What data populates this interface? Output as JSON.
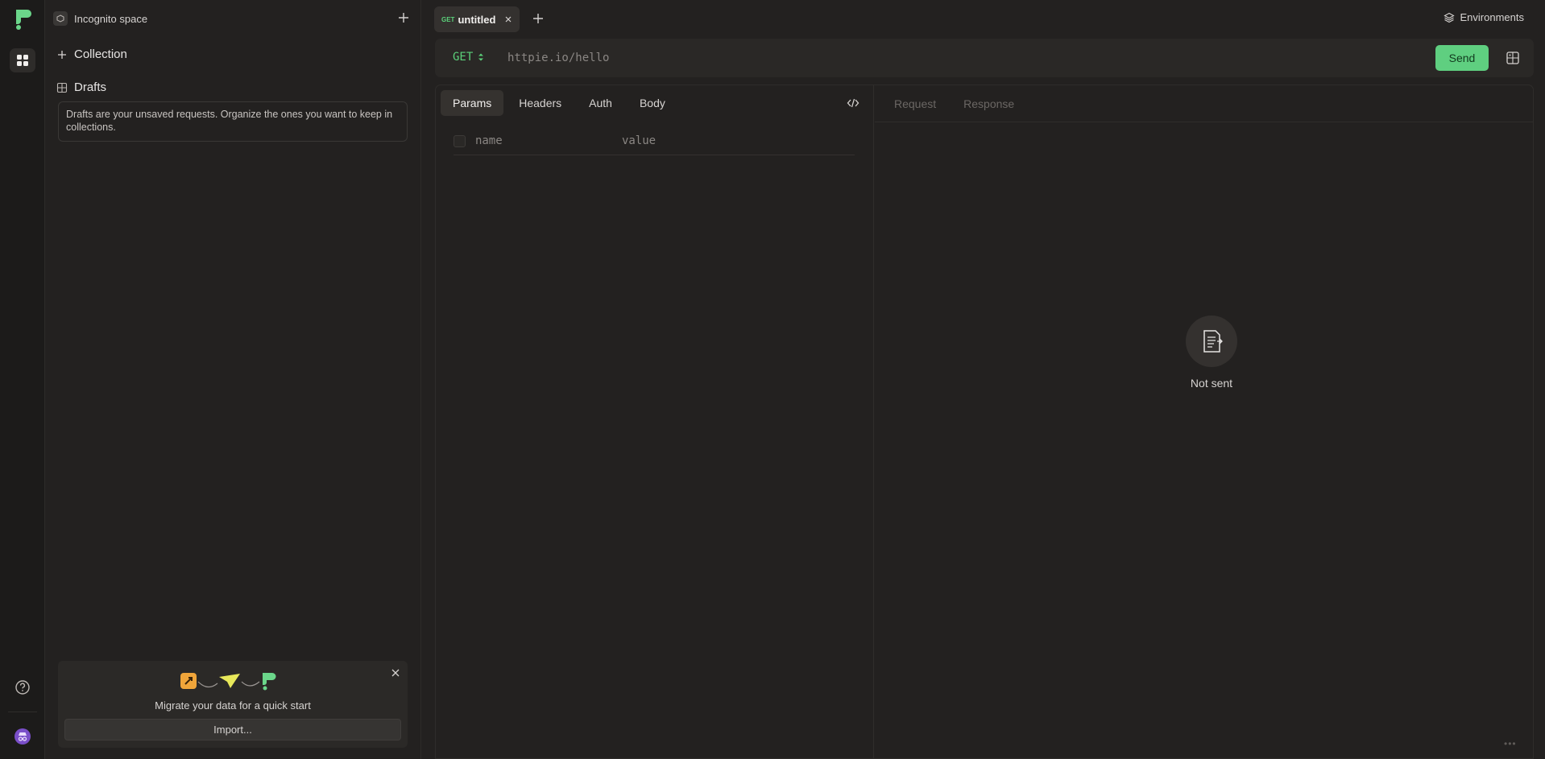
{
  "sidebar": {
    "space_name": "Incognito space",
    "collection_label": "Collection",
    "drafts_label": "Drafts",
    "drafts_note": "Drafts are your unsaved requests. Organize the ones you want to keep in collections."
  },
  "migrate": {
    "text": "Migrate your data for a quick start",
    "import_label": "Import..."
  },
  "tabs": [
    {
      "method": "GET",
      "title": "untitled"
    }
  ],
  "header": {
    "environments_label": "Environments"
  },
  "request": {
    "method": "GET",
    "url_placeholder": "httpie.io/hello",
    "send_label": "Send",
    "subtabs": [
      "Params",
      "Headers",
      "Auth",
      "Body"
    ],
    "params": {
      "name_placeholder": "name",
      "value_placeholder": "value"
    }
  },
  "response": {
    "tabs": [
      "Request",
      "Response"
    ],
    "empty_text": "Not sent"
  },
  "colors": {
    "accent": "#5fcf80",
    "method": "#5bd17a",
    "background": "#232120"
  }
}
